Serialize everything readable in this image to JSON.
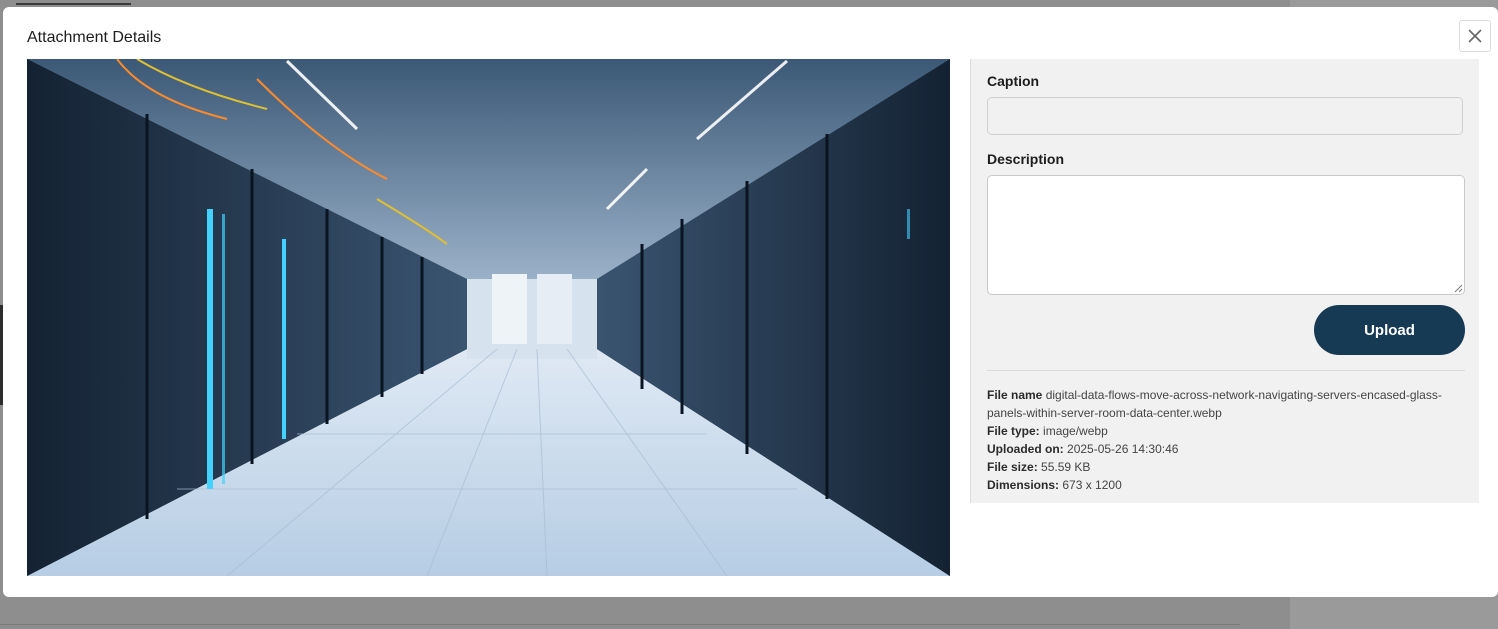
{
  "modal": {
    "title": "Attachment Details",
    "close_label": "×"
  },
  "form": {
    "caption_label": "Caption",
    "caption_value": "",
    "description_label": "Description",
    "description_value": "",
    "upload_label": "Upload"
  },
  "file_info": {
    "name_label": "File name",
    "name_value": "digital-data-flows-move-across-network-navigating-servers-encased-glass-panels-within-server-room-data-center.webp",
    "type_label": "File type:",
    "type_value": "image/webp",
    "uploaded_label": "Uploaded on:",
    "uploaded_value": "2025-05-26 14:30:46",
    "size_label": "File size:",
    "size_value": "55.59 KB",
    "dimensions_label": "Dimensions:",
    "dimensions_value": "673 x 1200"
  },
  "colors": {
    "primary_button": "#173a54",
    "panel_background": "#f1f1f1"
  },
  "icons": {
    "close": "close-icon"
  }
}
